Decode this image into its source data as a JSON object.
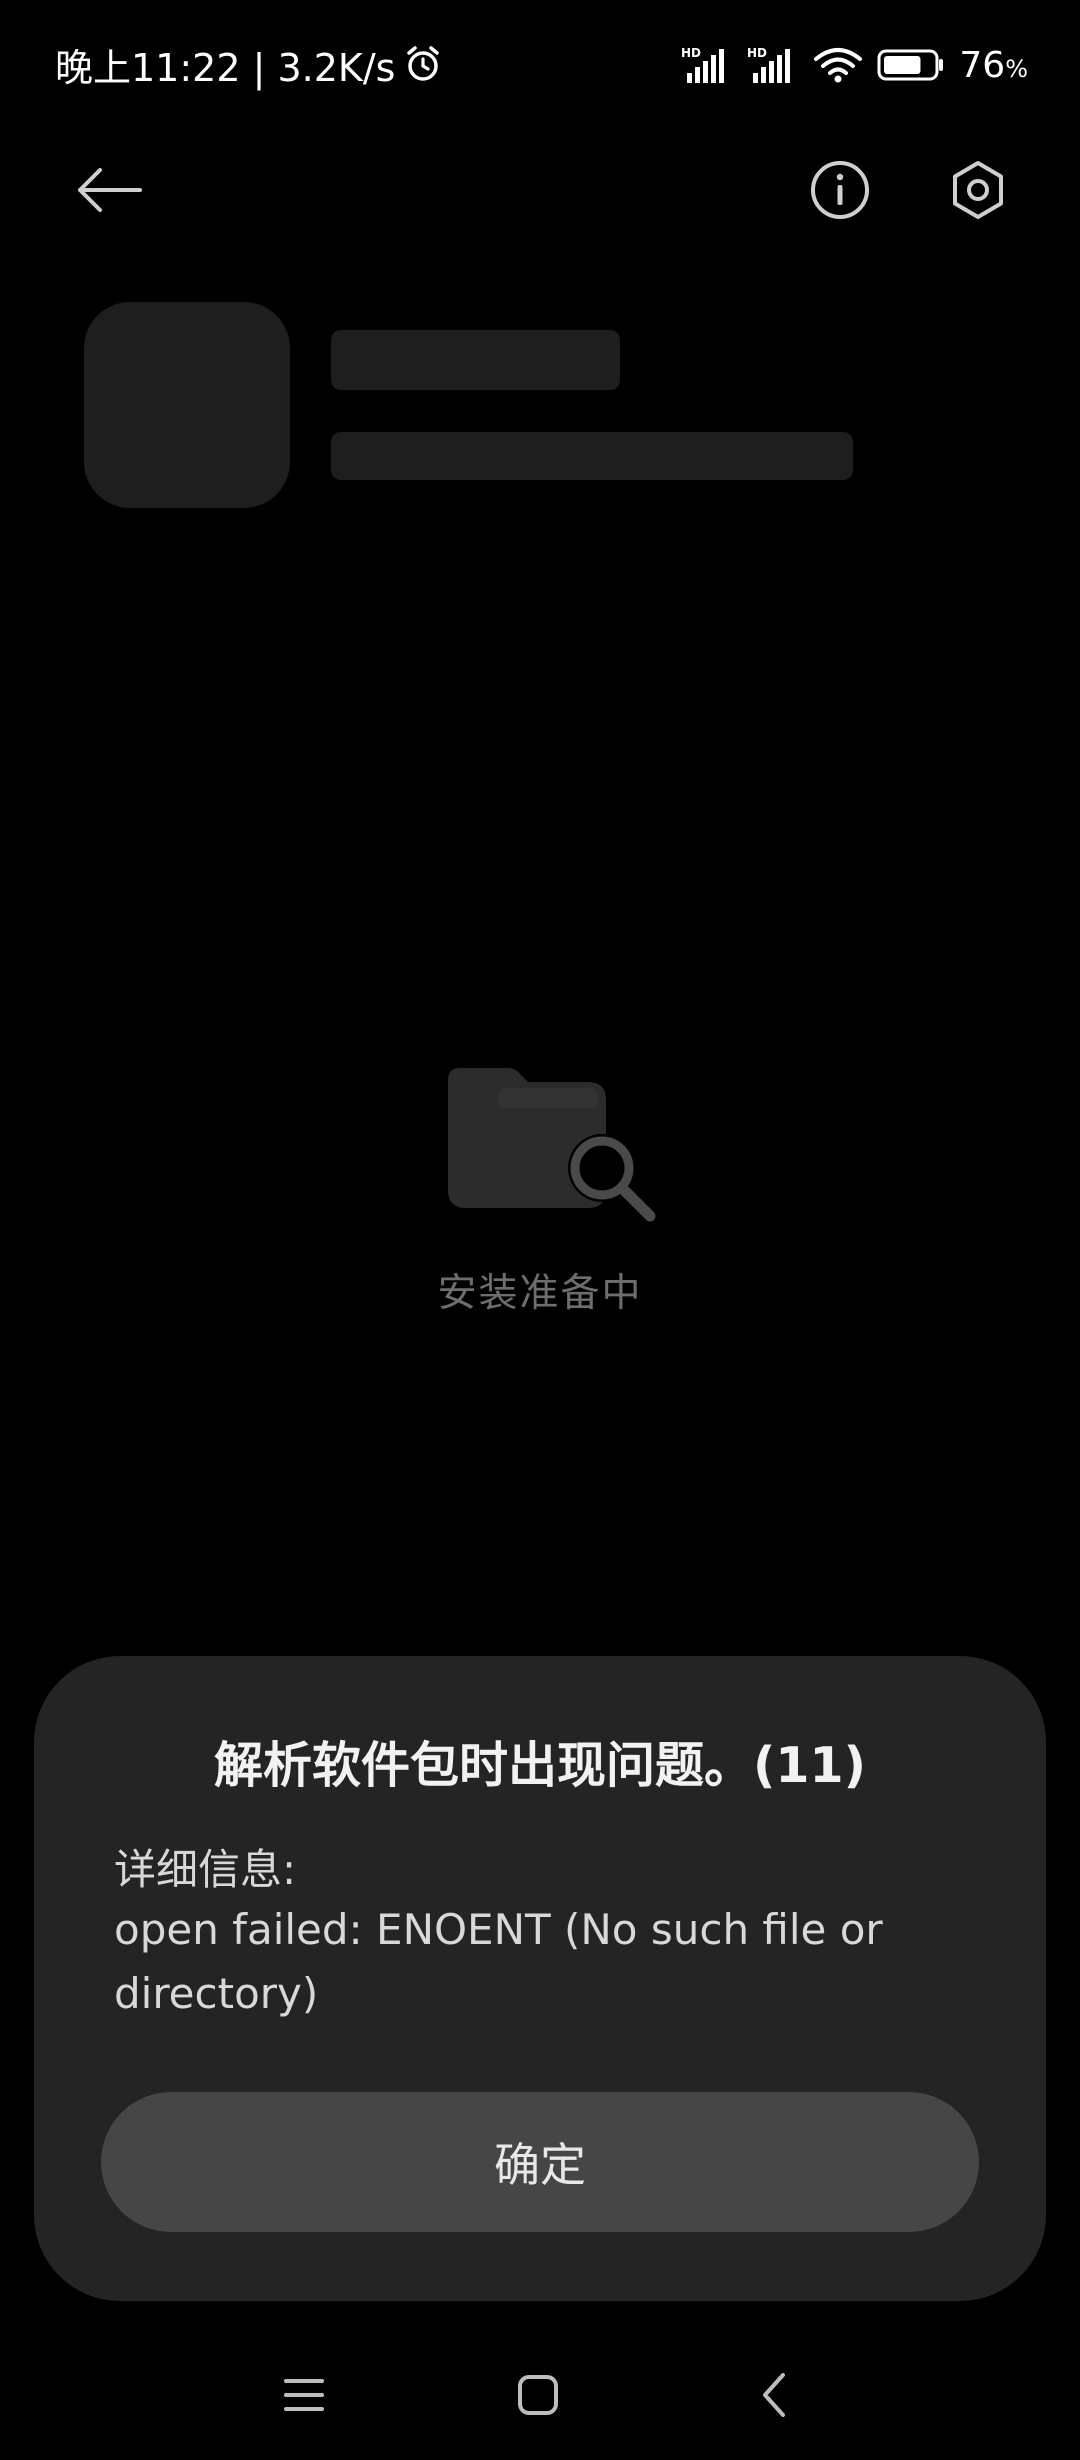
{
  "status_bar": {
    "time_text": "晚上11:22 | 3.2K/s",
    "alarm_icon": "alarm-icon",
    "signal_1_label": "HD",
    "signal_2_label": "HD",
    "wifi_icon": "wifi-icon",
    "battery_level": 0.76,
    "battery_percent": "76",
    "battery_percent_unit": "%"
  },
  "toolbar": {
    "back_icon": "back-arrow-icon",
    "info_icon": "info-icon",
    "settings_icon": "settings-icon"
  },
  "main": {
    "preparing_icon": "folder-search-icon",
    "preparing_text": "安装准备中"
  },
  "dialog": {
    "title": "解析软件包时出现问题。(11)",
    "detail_label": "详细信息:",
    "detail_message": "open failed: ENOENT (No such file or directory)",
    "ok_label": "确定"
  },
  "nav_bar": {
    "menu_icon": "menu-icon",
    "home_icon": "home-icon",
    "back_icon": "back-chevron-icon"
  },
  "colors": {
    "background": "#000000",
    "dialog_bg": "#242424",
    "button_bg": "#464646",
    "placeholder": "#1e1e1e",
    "muted_text": "#6e6e6e"
  }
}
